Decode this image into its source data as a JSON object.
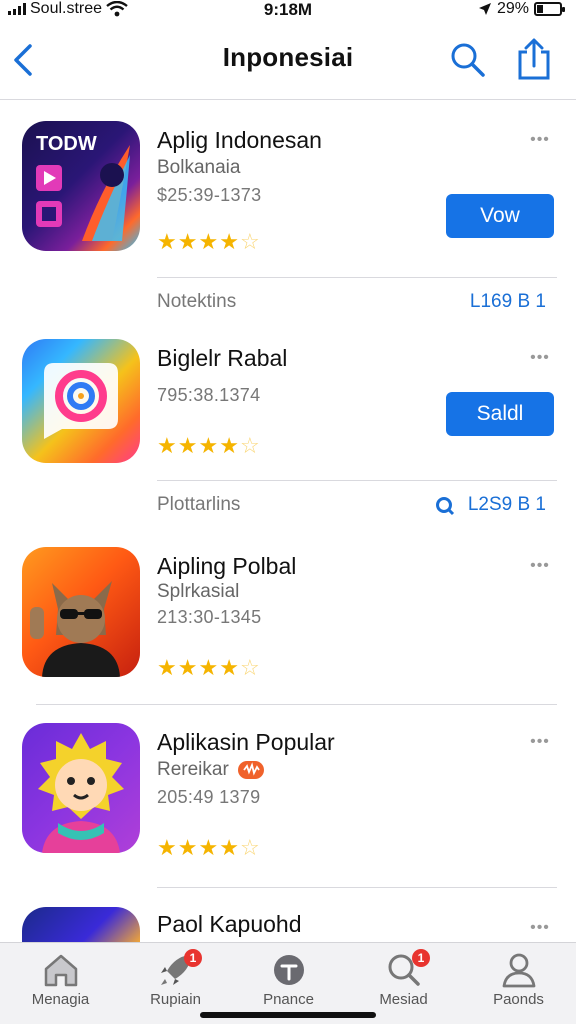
{
  "status_bar": {
    "carrier": "Soul.stree",
    "time": "9:18M",
    "battery": "29%",
    "battery_level": 0.29
  },
  "nav": {
    "title": "Inponesiai"
  },
  "apps": [
    {
      "name": "Aplig Indonesan",
      "subtitle": "Bolkanaia",
      "meta": "$25:39-1373",
      "rating": 4,
      "button_label": "Vow",
      "more": "•••",
      "icon": "colorful-media-app-icon",
      "icon_text": "TODW"
    },
    {
      "name": "Biglelr Rabal",
      "subtitle": "",
      "meta": "795:38.1374",
      "rating": 4,
      "button_label": "Saldl",
      "more": "•••",
      "icon": "rainbow-spiral-app-icon"
    },
    {
      "name": "Aipling Polbal",
      "subtitle": "Splrkasial",
      "meta": "213:30-1345",
      "rating": 4,
      "button_label": "",
      "more": "•••",
      "icon": "fox-character-app-icon"
    },
    {
      "name": "Aplikasin Popular",
      "subtitle": "Rereikar",
      "meta": "205:49 1379",
      "rating": 4,
      "button_label": "",
      "more": "•••",
      "icon": "lion-character-app-icon"
    },
    {
      "name": "Paol Kapuohd",
      "subtitle": "",
      "meta": "",
      "rating": null,
      "button_label": "",
      "more": "•••",
      "icon": "partial-app-icon"
    }
  ],
  "footnotes": [
    {
      "label": "Notektins",
      "value": "L169 B 1"
    },
    {
      "label": "Plottarlins",
      "value": "L2S9 B 1"
    }
  ],
  "tabs": [
    {
      "label": "Menagia",
      "icon": "house-icon",
      "badge": ""
    },
    {
      "label": "Rupiain",
      "icon": "rocket-icon",
      "badge": "1"
    },
    {
      "label": "Pnance",
      "icon": "finance-icon",
      "badge": ""
    },
    {
      "label": "Mesiad",
      "icon": "search-icon",
      "badge": "1"
    },
    {
      "label": "Paonds",
      "icon": "person-icon",
      "badge": ""
    }
  ],
  "colors": {
    "accent": "#1673e6",
    "star": "#f5b400",
    "badge": "#e8342f"
  }
}
